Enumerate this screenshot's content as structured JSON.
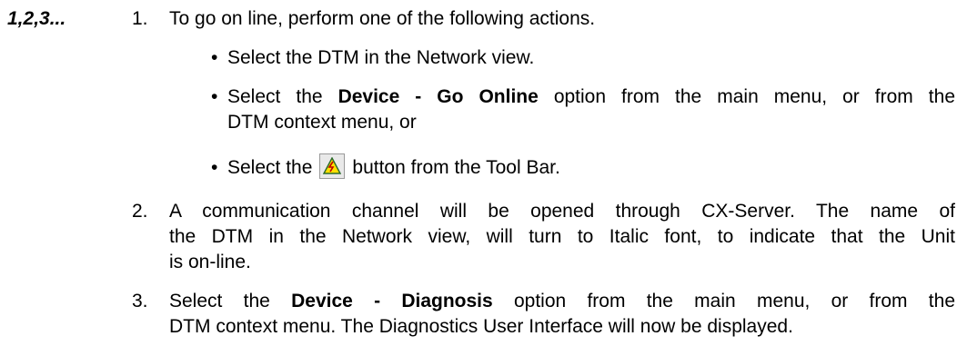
{
  "marker": "1,2,3...",
  "steps": [
    {
      "number": "1.",
      "text": "To go on line, perform one of the following actions."
    },
    {
      "number": "2.",
      "lines": [
        "A communication channel will be opened through CX-Server. The name of",
        "the DTM in the Network view, will turn to Italic font, to indicate that the Unit",
        "is on-line."
      ]
    },
    {
      "number": "3.",
      "pre": "Select the ",
      "bold": "Device - Diagnosis",
      "post": " option from the main menu, or from the",
      "line2": "DTM context menu. The Diagnostics User Interface will now be displayed."
    }
  ],
  "bullets": [
    {
      "text": "Select the DTM in the Network view."
    },
    {
      "pre": "Select the ",
      "bold": "Device - Go Online",
      "post": " option from the main menu, or from the",
      "line2": "DTM context menu, or"
    },
    {
      "pre": "Select the",
      "post": "button from the Tool Bar.",
      "icon": "go-online-icon"
    }
  ],
  "bullet_char": "•",
  "colors": {
    "icon_fill": "#ffe000",
    "icon_edge": "#2a6a2a"
  }
}
